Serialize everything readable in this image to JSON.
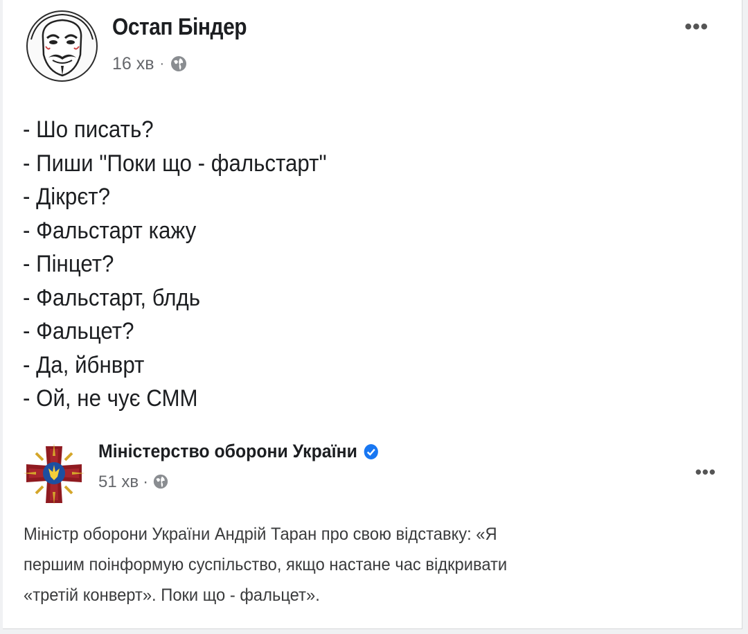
{
  "post": {
    "author": "Остап Біндер",
    "time": "16 хв",
    "separator": "·",
    "more_label": "•••",
    "lines": [
      "- Шо писать?",
      "- Пиши \"Поки що - фальстарт\"",
      "- Дікрєт?",
      "- Фальстарт кажу",
      "- Пінцет?",
      "- Фальстарт, блдь",
      "- Фальцет?",
      "- Да, йбнврт",
      "- Ой, не чує СММ"
    ]
  },
  "shared_post": {
    "author": "Міністерство оборони України",
    "time": "51 хв",
    "separator": "·",
    "more_label": "•••",
    "lines": [
      "Міністр оборони України Андрій Таран про свою відставку: «Я",
      "першим поінформую  суспільство, якщо настане час відкривати",
      "«третій конверт». Поки що - фальцет»."
    ]
  },
  "icons": {
    "avatar": "guy-fawkes-mask-avatar",
    "privacy": "globe-icon",
    "verified": "verified-badge-icon",
    "ministry_logo": "ministry-emblem-icon"
  },
  "colors": {
    "verified": "#1877f2",
    "meta_text": "#65676b",
    "emblem_red": "#8f1a20",
    "emblem_gold": "#d4a62a"
  }
}
